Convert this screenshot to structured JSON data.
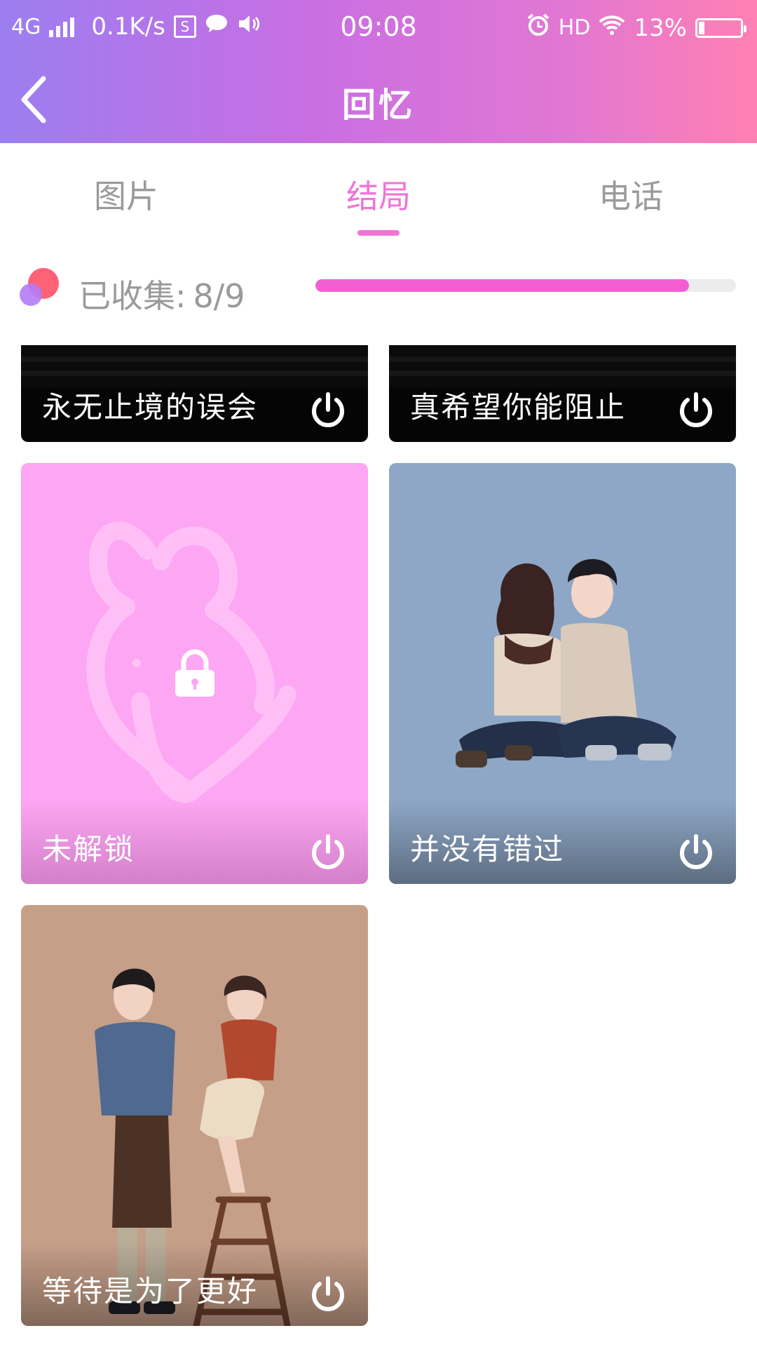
{
  "status_bar": {
    "network": "4G",
    "speed": "0.1K/s",
    "time": "09:08",
    "hd": "HD",
    "battery": "13%",
    "battery_level": 0.13
  },
  "header": {
    "title": "回忆"
  },
  "tabs": [
    {
      "label": "图片",
      "active": false
    },
    {
      "label": "结局",
      "active": true
    },
    {
      "label": "电话",
      "active": false
    }
  ],
  "progress": {
    "label": "已收集:",
    "value": "8/9",
    "fraction": 0.889
  },
  "cards": [
    {
      "title": "永无止境的误会",
      "style": "black"
    },
    {
      "title": "真希望你能阻止",
      "style": "black"
    },
    {
      "title": "未解锁",
      "style": "locked"
    },
    {
      "title": "并没有错过",
      "style": "illustration"
    },
    {
      "title": "等待是为了更好",
      "style": "illustration"
    }
  ],
  "colors": {
    "accent": "#f174d7",
    "progress_fill": "#f35ed2",
    "locked_card": "#fda6f3",
    "card_blue": "#8ea7c6",
    "card_brown": "#c69f89"
  },
  "icons": {
    "back": "back-chevron-icon",
    "card_action": "power-icon",
    "locked": "lock-icon"
  }
}
